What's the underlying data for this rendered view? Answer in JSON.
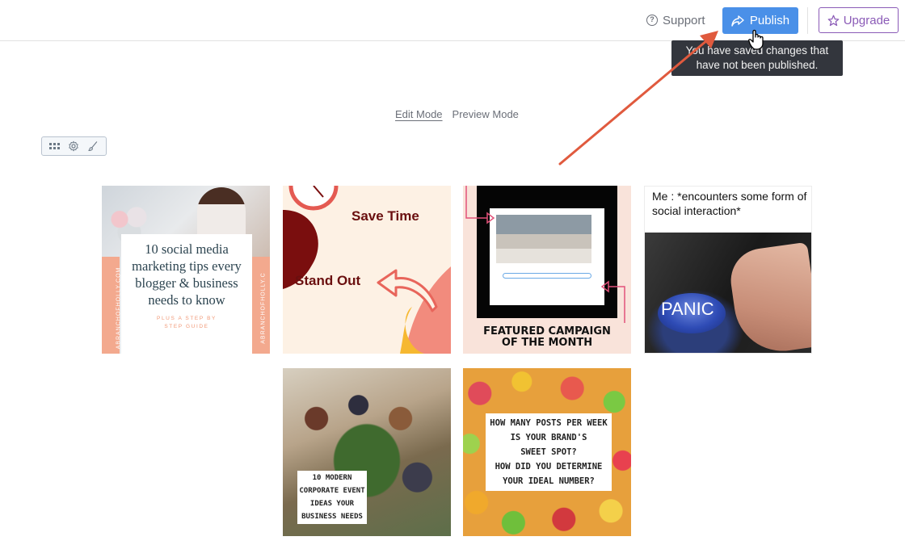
{
  "header": {
    "support_label": "Support",
    "publish_label": "Publish",
    "upgrade_label": "Upgrade",
    "accent_color": "#4a90e8",
    "upgrade_color": "#8b5bb7"
  },
  "tooltip": {
    "line1": "You have saved changes that",
    "line2": "have not been published."
  },
  "modes": {
    "edit_label": "Edit Mode",
    "preview_label": "Preview Mode",
    "active": "Edit Mode"
  },
  "toolbox": {
    "icons": [
      "grid-icon",
      "gear-icon",
      "brush-icon"
    ]
  },
  "gallery": {
    "tile1": {
      "headline": "10 social media marketing tips every blogger & business needs to know",
      "subline1": "PLUS A STEP BY",
      "subline2": "STEP GUIDE",
      "side_left": "ABRANCHOFHOLLY.COM",
      "side_right": "ABRANCHOFHOLLY.C"
    },
    "tile2": {
      "text1": "Save Time",
      "text2": "Stand Out"
    },
    "tile3": {
      "caption_line1": "FEATURED CAMPAIGN",
      "caption_line2": "OF THE MONTH"
    },
    "tile4": {
      "meme_text": "Me : *encounters some form of social interaction*",
      "button_text": "PANIC"
    },
    "tile5": {
      "line1": "10 MODERN",
      "line2": "CORPORATE EVENT",
      "line3": "IDEAS YOUR",
      "line4": "BUSINESS NEEDS"
    },
    "tile6": {
      "line1": "HOW MANY POSTS PER WEEK",
      "line2": "IS YOUR BRAND'S",
      "line3": "SWEET SPOT?",
      "line4": "HOW DID YOU DETERMINE",
      "line5": "YOUR IDEAL NUMBER?"
    }
  }
}
